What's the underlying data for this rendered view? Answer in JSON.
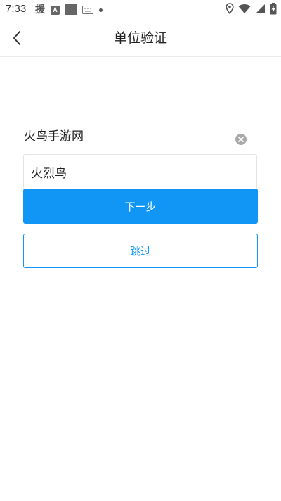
{
  "status_bar": {
    "time": "7:33",
    "notification_char": "援",
    "badge_letter": "A",
    "icons": [
      "location-icon",
      "wifi-icon",
      "signal-icon",
      "battery-charging-icon"
    ]
  },
  "header": {
    "title": "单位验证",
    "back_icon": "chevron-left-icon"
  },
  "form": {
    "company_label": "火鸟手游网",
    "clear_icon": "clear-circle-icon",
    "input_value": "火烈鸟"
  },
  "actions": {
    "next_label": "下一步",
    "skip_label": "跳过"
  },
  "colors": {
    "primary": "#1296f5",
    "text": "#222222",
    "border": "#e3e3e3",
    "background": "#ffffff"
  }
}
